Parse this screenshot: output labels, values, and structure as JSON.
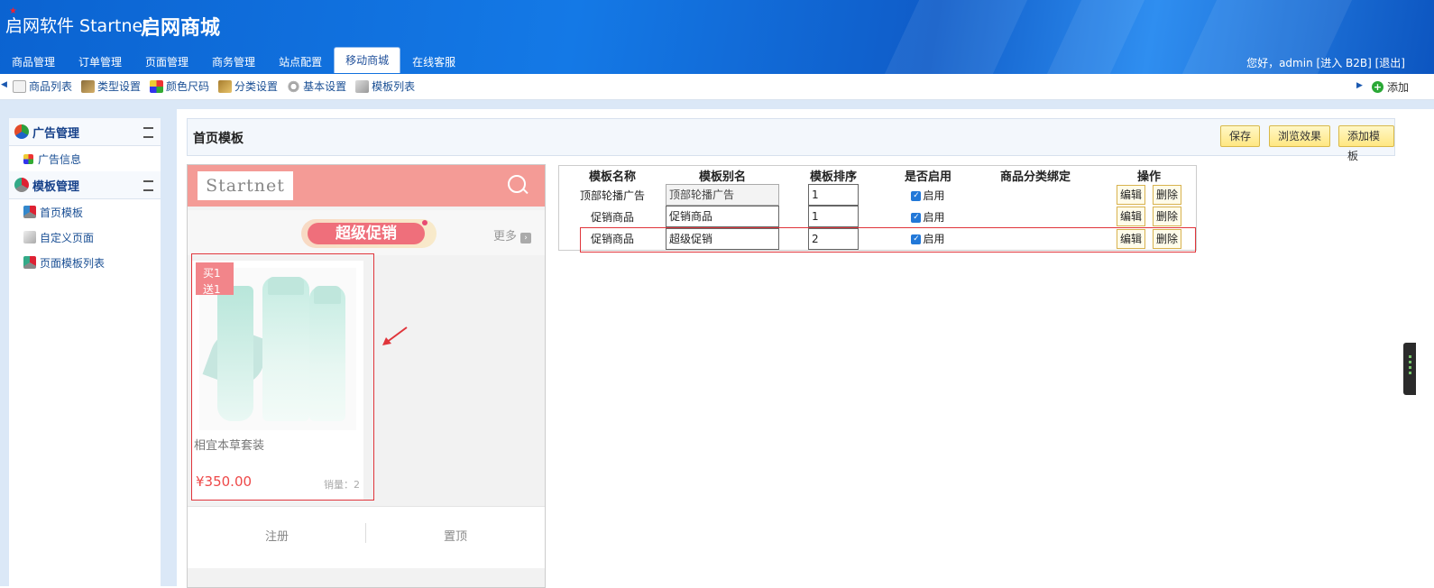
{
  "header": {
    "logo_text": "启网软件 Startnet",
    "brand": "启网商城",
    "greeting": "您好，admin",
    "enter_b2b": "[进入 B2B]",
    "logout": "[退出]",
    "nav_tabs": [
      "商品管理",
      "订单管理",
      "页面管理",
      "商务管理",
      "站点配置",
      "移动商城",
      "在线客服"
    ],
    "active_tab": "移动商城"
  },
  "subbar": {
    "items": [
      "商品列表",
      "类型设置",
      "颜色尺码",
      "分类设置",
      "基本设置",
      "模板列表"
    ],
    "add_label": "添加"
  },
  "sidebar": {
    "groups": [
      {
        "title": "广告管理",
        "items": [
          "广告信息"
        ]
      },
      {
        "title": "模板管理",
        "items": [
          "首页模板",
          "自定义页面",
          "页面模板列表"
        ]
      }
    ]
  },
  "panel": {
    "title": "首页模板",
    "buttons": [
      "保存",
      "浏览效果",
      "添加模板"
    ]
  },
  "phone": {
    "logo": "Startnet",
    "promo_title": "超级促销",
    "more": "更多",
    "product": {
      "tag_line1": "买1",
      "tag_line2": "送1",
      "name": "相宜本草套装",
      "price": "¥350.00",
      "sold": "销量：2"
    },
    "footer": [
      "注册",
      "置顶"
    ]
  },
  "table": {
    "headers": [
      "模板名称",
      "模板别名",
      "模板排序",
      "是否启用",
      "商品分类绑定",
      "操作"
    ],
    "rows": [
      {
        "name": "顶部轮播广告",
        "alias": "顶部轮播广告",
        "sort": "1",
        "enabled_label": "启用",
        "edit": "编辑",
        "delete": "删除"
      },
      {
        "name": "促销商品",
        "alias": "促销商品",
        "sort": "1",
        "enabled_label": "启用",
        "edit": "编辑",
        "delete": "删除"
      },
      {
        "name": "促销商品",
        "alias": "超级促销",
        "sort": "2",
        "enabled_label": "启用",
        "edit": "编辑",
        "delete": "删除"
      }
    ]
  },
  "colors": {
    "header_blue": "#1479e6",
    "phone_top_pink": "#f49b96",
    "promo_badge": "#ef6f7b",
    "price_red": "#ee4848",
    "highlight_red": "#e0353b",
    "button_yellow": "#ffe782"
  }
}
